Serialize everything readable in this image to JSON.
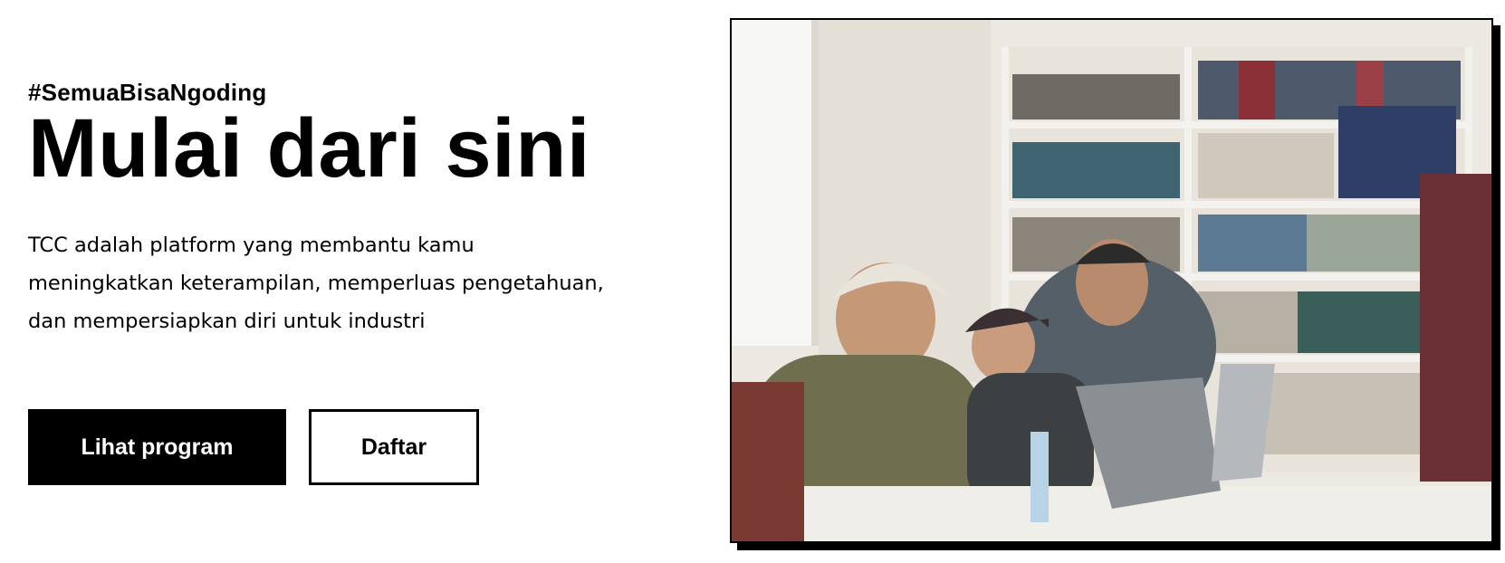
{
  "hero": {
    "hashtag": "#SemuaBisaNgoding",
    "title": "Mulai dari sini",
    "description_lines": [
      "TCC adalah platform yang membantu kamu",
      "meningkatkan keterampilan, memperluas pengetahuan,",
      "dan mempersiapkan diri untuk industri"
    ]
  },
  "buttons": {
    "primary_label": "Lihat program",
    "secondary_label": "Daftar"
  },
  "colors": {
    "primary_bg": "#000000",
    "primary_text": "#ffffff",
    "page_bg": "#ffffff"
  }
}
